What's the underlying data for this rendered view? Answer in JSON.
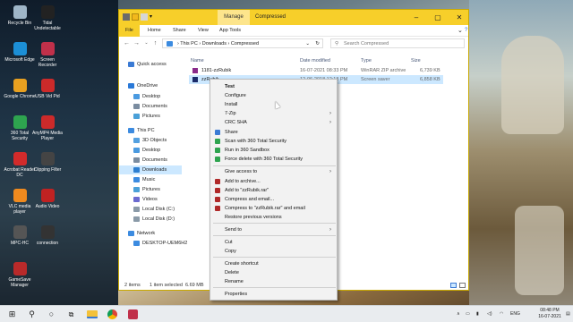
{
  "desktop": {
    "icons": [
      {
        "label": "Recycle Bin",
        "color": "#9fb6c8"
      },
      {
        "label": "Tidal Undetectable",
        "color": "#222222"
      },
      {
        "label": "Microsoft Edge",
        "color": "#1c8fd6"
      },
      {
        "label": "Screen Recorder",
        "color": "#c0304a"
      },
      {
        "label": "Google Chrome",
        "color": "#e8a020"
      },
      {
        "label": "USB Vid Pid",
        "color": "#cc2a2a"
      },
      {
        "label": "360 Total Security",
        "color": "#2ea44f"
      },
      {
        "label": "AnyMP4 Media Player",
        "color": "#cc2a2a"
      },
      {
        "label": "Acrobat Reader DC",
        "color": "#d22b2b"
      },
      {
        "label": "Clipping Filter",
        "color": "#444444"
      },
      {
        "label": "VLC media player",
        "color": "#f08a1e"
      },
      {
        "label": "Audio Video",
        "color": "#c02222"
      },
      {
        "label": "MPC-HC",
        "color": "#555555"
      },
      {
        "label": "connection",
        "color": "#333333"
      },
      {
        "label": "GameSave Manager",
        "color": "#b92a2a"
      }
    ]
  },
  "window": {
    "manage_tab": "Manage",
    "title": "Compressed",
    "ribbon_tabs": [
      "File",
      "Home",
      "Share",
      "View",
      "App Tools"
    ],
    "breadcrumb": [
      "This PC",
      "Downloads",
      "Compressed"
    ],
    "search_placeholder": "Search Compressed",
    "nav": [
      {
        "label": "Quick access",
        "color": "#3a7ad4"
      },
      {
        "label": "OneDrive",
        "color": "#2a79d8"
      },
      {
        "label": "Desktop",
        "color": "#4a9ae0"
      },
      {
        "label": "Documents",
        "color": "#7a8ca0"
      },
      {
        "label": "Pictures",
        "color": "#4aa0d8"
      },
      {
        "label": "This PC",
        "color": "#3c8be0"
      },
      {
        "label": "3D Objects",
        "color": "#53a0e0"
      },
      {
        "label": "Desktop",
        "color": "#4a9ae0"
      },
      {
        "label": "Documents",
        "color": "#7a8ca0"
      },
      {
        "label": "Downloads",
        "color": "#2d7ed0"
      },
      {
        "label": "Music",
        "color": "#3c8be0"
      },
      {
        "label": "Pictures",
        "color": "#4aa0d8"
      },
      {
        "label": "Videos",
        "color": "#6a6ad0"
      },
      {
        "label": "Local Disk (C:)",
        "color": "#8a9aa8"
      },
      {
        "label": "Local Disk (D:)",
        "color": "#8a9aa8"
      },
      {
        "label": "Network",
        "color": "#3c8be0"
      },
      {
        "label": "DESKTOP-UEM6H2",
        "color": "#3c8be0"
      }
    ],
    "columns": [
      "Name",
      "Date modified",
      "Type",
      "Size"
    ],
    "files": [
      {
        "name": "1181-zzRubik",
        "date": "16-07-2021 08:33 PM",
        "type": "WinRAR ZIP archive",
        "size": "6,739 KB",
        "color": "#8a2a8a"
      },
      {
        "name": "zzRubik",
        "date": "12-06-2018 12:18 PM",
        "type": "Screen saver",
        "size": "6,858 KB",
        "color": "#1a2a6a"
      }
    ],
    "status": {
      "count": "2 items",
      "selected": "1 item selected",
      "size": "6.69 MB"
    }
  },
  "context_menu": {
    "items": [
      {
        "label": "Test",
        "bold": true
      },
      {
        "label": "Configure"
      },
      {
        "label": "Install"
      },
      {
        "label": "7-Zip",
        "submenu": true
      },
      {
        "label": "CRC SHA",
        "submenu": true
      },
      {
        "label": "Share",
        "icon": "#3a7ad4"
      },
      {
        "label": "Scan with 360 Total Security",
        "icon": "#2ea44f"
      },
      {
        "label": "Run in 360 Sandbox",
        "icon": "#2ea44f"
      },
      {
        "label": "Force delete with 360 Total Security",
        "icon": "#2ea44f"
      },
      {
        "label": "Give access to",
        "submenu": true
      },
      {
        "label": "Add to archive...",
        "icon": "#b02a2a"
      },
      {
        "label": "Add to \"zzRubik.rar\"",
        "icon": "#b02a2a"
      },
      {
        "label": "Compress and email...",
        "icon": "#b02a2a"
      },
      {
        "label": "Compress to \"zzRubik.rar\" and email",
        "icon": "#b02a2a"
      },
      {
        "label": "Restore previous versions"
      },
      {
        "label": "Send to",
        "submenu": true
      },
      {
        "label": "Cut"
      },
      {
        "label": "Copy"
      },
      {
        "label": "Create shortcut"
      },
      {
        "label": "Delete"
      },
      {
        "label": "Rename"
      },
      {
        "label": "Properties"
      }
    ]
  },
  "taskbar": {
    "tray_lang": "ENG",
    "time": "08:48 PM",
    "date": "16-07-2021"
  }
}
